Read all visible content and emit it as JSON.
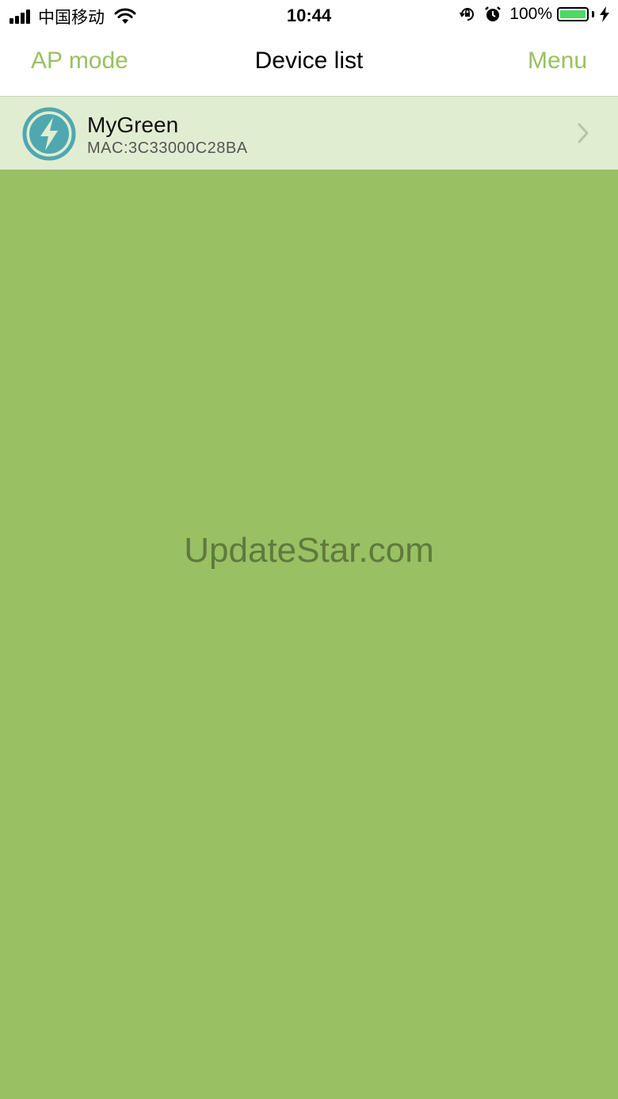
{
  "status_bar": {
    "carrier": "中国移动",
    "time": "10:44",
    "battery_percent": "100%",
    "battery_level": 1.0,
    "icons": [
      "signal-icon",
      "wifi-icon",
      "orientation-lock-icon",
      "alarm-icon",
      "battery-icon",
      "charging-bolt-icon"
    ]
  },
  "nav": {
    "left_label": "AP mode",
    "title": "Device list",
    "right_label": "Menu"
  },
  "devices": [
    {
      "name": "MyGreen",
      "mac": "MAC:3C33000C28BA",
      "icon": "lightning-bolt-icon"
    }
  ],
  "watermark": "UpdateStar.com",
  "colors": {
    "accent_green": "#99c063",
    "row_background": "#e1edd1",
    "device_icon": "#4fa8b0"
  }
}
